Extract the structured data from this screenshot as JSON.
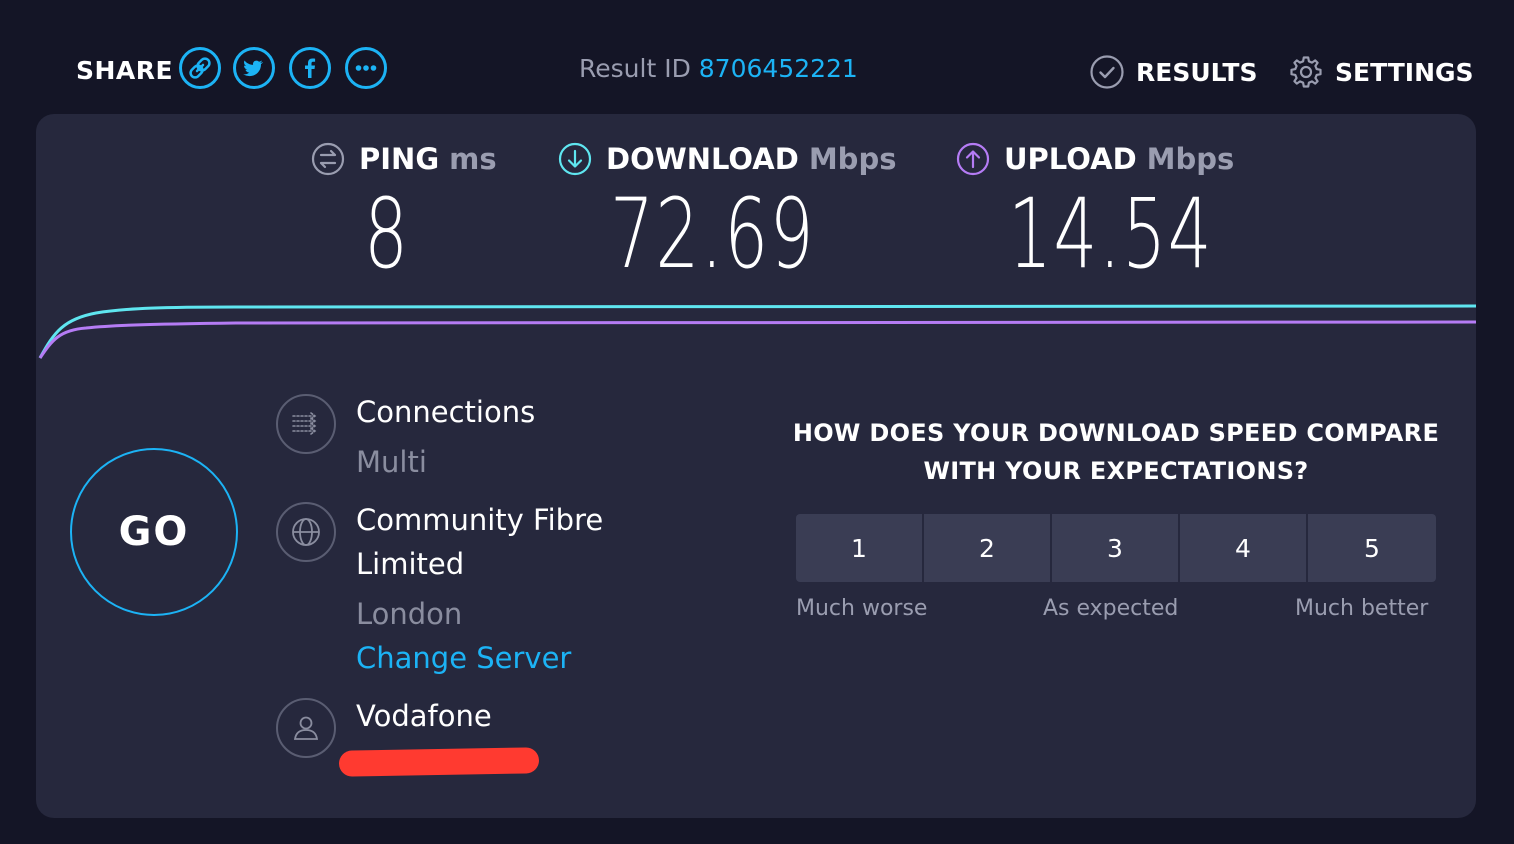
{
  "header": {
    "share_label": "SHARE",
    "share_icons": [
      "link-icon",
      "twitter-icon",
      "facebook-icon",
      "more-icon"
    ],
    "result_id_label": "Result ID",
    "result_id_value": "8706452221",
    "results_label": "RESULTS",
    "settings_label": "SETTINGS"
  },
  "metrics": {
    "ping": {
      "label": "PING",
      "unit": "ms",
      "value": "8"
    },
    "download": {
      "label": "DOWNLOAD",
      "unit": "Mbps",
      "value": "72.69"
    },
    "upload": {
      "label": "UPLOAD",
      "unit": "Mbps",
      "value": "14.54"
    }
  },
  "go_label": "GO",
  "info": {
    "connections_title": "Connections",
    "connections_value": "Multi",
    "host_line1": "Community Fibre",
    "host_line2": "Limited",
    "host_location": "London",
    "change_server": "Change Server",
    "isp_name": "Vodafone"
  },
  "survey": {
    "question": "HOW DOES YOUR DOWNLOAD SPEED COMPARE WITH YOUR EXPECTATIONS?",
    "options": [
      "1",
      "2",
      "3",
      "4",
      "5"
    ],
    "label_low": "Much worse",
    "label_mid": "As expected",
    "label_high": "Much better"
  },
  "colors": {
    "background": "#141526",
    "panel": "#26283d",
    "accent_blue": "#1cb3f5",
    "download_line": "#5fe6f0",
    "upload_line": "#b57cf5",
    "redaction": "#ff3a30"
  }
}
